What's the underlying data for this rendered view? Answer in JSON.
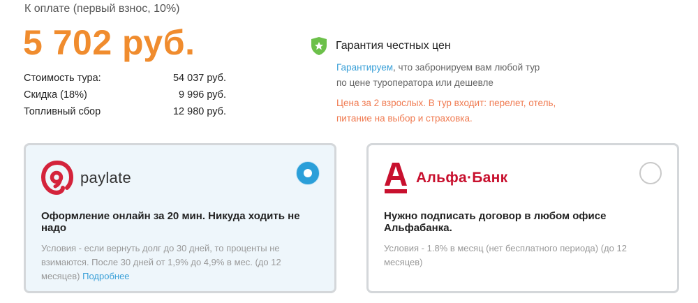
{
  "payment": {
    "title": "К оплате (первый взнос, 10%)",
    "amount": "5 702 руб.",
    "costs": [
      {
        "label": "Стоимость тура:",
        "value": "54 037 руб."
      },
      {
        "label": "Скидка (18%)",
        "value": "9 996 руб."
      },
      {
        "label": "Топливный сбор",
        "value": "12 980 руб."
      }
    ]
  },
  "guarantee": {
    "title": "Гарантия честных цен",
    "link_text": "Гарантируем",
    "text": ", что забронируем вам любой тур по цене туроператора или дешевле",
    "price_note": "Цена за 2 взрослых. В тур входит: перелет, отель, питание на выбор и страховка."
  },
  "options": [
    {
      "logo_text": "paylate",
      "selected": true,
      "heading": "Оформление онлайн за 20 мин. Никуда ходить не надо",
      "conditions": "Условия - если вернуть долг до 30 дней, то проценты не взимаются. После 30 дней от 1,9% до 4,9% в мес. (до 12 месяцев)",
      "more_link": "Подробнее"
    },
    {
      "logo_text": "Альфа·Банк",
      "selected": false,
      "heading": "Нужно подписать договор в любом офисе Альфабанка.",
      "conditions": "Условия - 1.8% в месяц (нет бесплатного периода) (до 12 месяцев)"
    }
  ],
  "colors": {
    "accent_orange": "#f08c2e",
    "link_blue": "#3aa0d8",
    "note_orange": "#f07a50",
    "shield_green": "#6cc04a",
    "paylate_red": "#d4233b",
    "alfa_red": "#c8102e",
    "radio_blue": "#2b9fd9"
  }
}
